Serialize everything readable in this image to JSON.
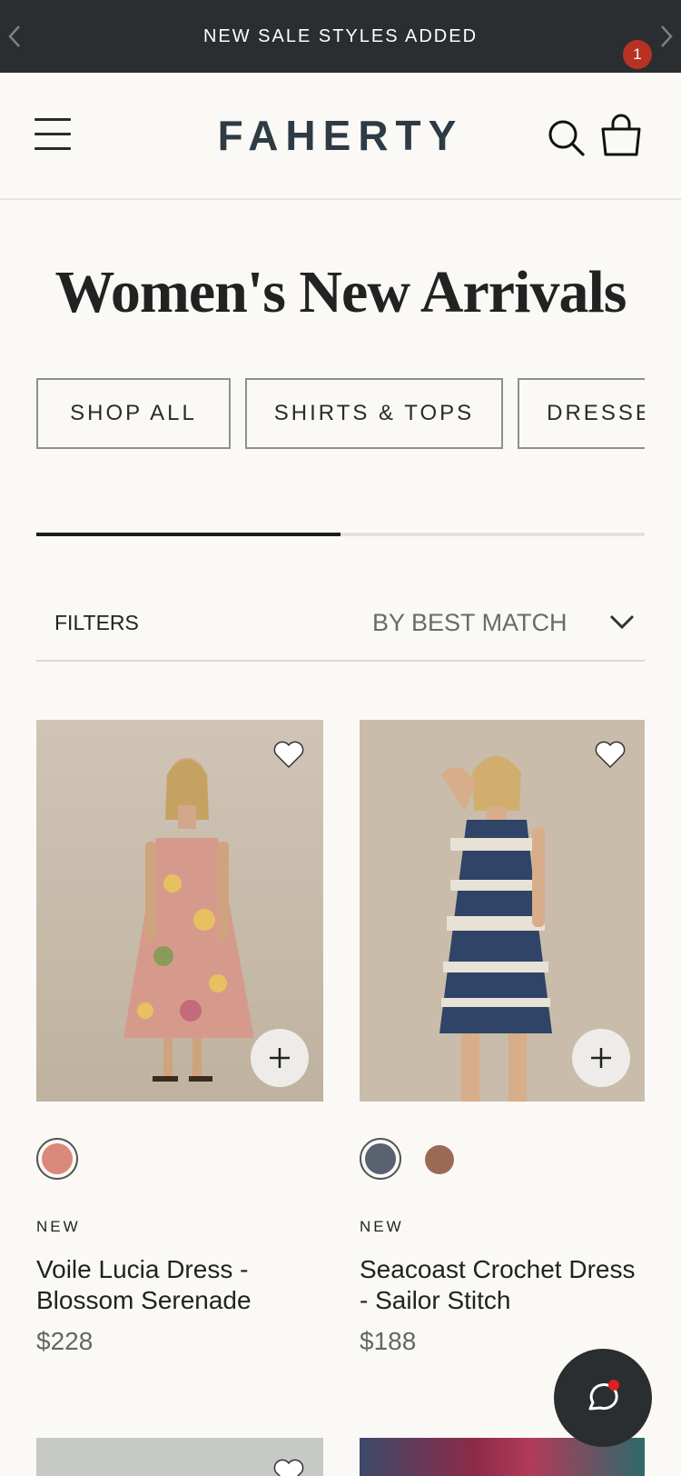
{
  "promo": {
    "message": "NEW SALE STYLES ADDED"
  },
  "header": {
    "logo": "FAHERTY",
    "cart_count": "1"
  },
  "page": {
    "title": "Women's New Arrivals"
  },
  "categories": [
    {
      "label": "SHOP ALL"
    },
    {
      "label": "SHIRTS & TOPS"
    },
    {
      "label": "DRESSES"
    }
  ],
  "carousel_progress": 0.5,
  "filters": {
    "filters_label": "FILTERS",
    "sort_label": "BY BEST MATCH"
  },
  "products": [
    {
      "badge": "NEW",
      "name": "Voile Lucia Dress - Blossom Serenade",
      "price": "$228",
      "swatch_colors": [
        "#d98a7a"
      ]
    },
    {
      "badge": "NEW",
      "name": "Seacoast Crochet Dress - Sailor Stitch",
      "price": "$188",
      "swatch_colors": [
        "#5a6270",
        "#9a6a55"
      ]
    }
  ],
  "colors": {
    "promo_bg": "#2a2e30",
    "logo": "#2e3a44",
    "badge": "#b83224",
    "chat_dot": "#e02020"
  }
}
